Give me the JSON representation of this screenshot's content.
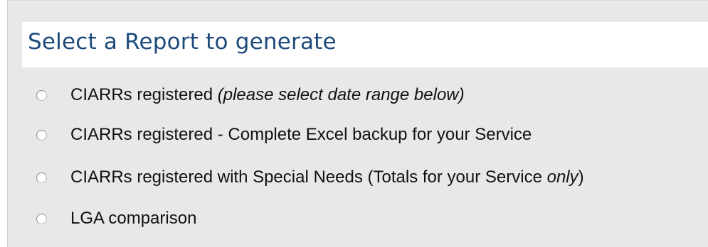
{
  "report_panel": {
    "title": "Select a Report to generate",
    "options": [
      {
        "label": "CIARRs registered",
        "note": "(please select date range below)",
        "selected": false
      },
      {
        "label": "CIARRs registered - Complete Excel backup for your Service",
        "selected": false
      },
      {
        "label_before": "CIARRs registered with Special Needs (Totals for your Service ",
        "label_emphasis": "only",
        "label_after": ")",
        "selected": false
      },
      {
        "label": "LGA comparison",
        "selected": false
      }
    ]
  },
  "colors": {
    "panel_background": "#e8e8e8",
    "header_background": "#ffffff",
    "title_text": "#1d4a7a",
    "option_text": "#111111"
  }
}
